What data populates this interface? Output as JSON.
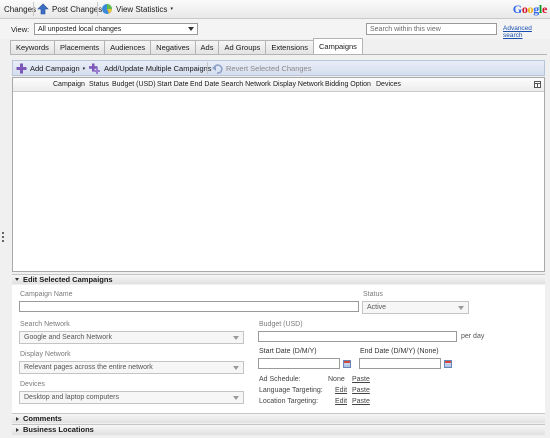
{
  "toolbar": {
    "changes": "Changes",
    "post_changes": "Post Changes",
    "view_statistics": "View Statistics",
    "logo": "Google"
  },
  "view": {
    "label": "View:",
    "selected": "All unposted local changes",
    "search_placeholder": "Search within this view",
    "advanced_search": "Advanced search"
  },
  "tabs": [
    "Keywords",
    "Placements",
    "Audiences",
    "Negatives",
    "Ads",
    "Ad Groups",
    "Extensions",
    "Campaigns"
  ],
  "active_tab": "Campaigns",
  "actions": {
    "add_campaign": "Add Campaign",
    "add_update_multiple": "Add/Update Multiple Campaigns",
    "revert": "Revert Selected Changes"
  },
  "grid": {
    "columns": [
      "Campaign",
      "Status",
      "Budget (USD)",
      "Start Date",
      "End Date",
      "Search Network",
      "Display Network",
      "Bidding Option",
      "Devices"
    ]
  },
  "edit": {
    "header": "Edit Selected Campaigns",
    "campaign_name_label": "Campaign Name",
    "status_label": "Status",
    "status_value": "Active",
    "search_network_label": "Search Network",
    "search_network_value": "Google and Search Network",
    "budget_label": "Budget (USD)",
    "per_day": "per day",
    "display_network_label": "Display Network",
    "display_network_value": "Relevant pages across the entire network",
    "start_date_label": "Start Date (D/M/Y)",
    "end_date_label": "End Date (D/M/Y) (None)",
    "devices_label": "Devices",
    "devices_value": "Desktop and laptop computers",
    "ad_schedule_label": "Ad Schedule:",
    "ad_schedule_value": "None",
    "paste": "Paste",
    "language_label": "Language Targeting:",
    "location_label": "Location Targeting:",
    "edit_link": "Edit"
  },
  "sections": {
    "comments": "Comments",
    "business_locations": "Business Locations"
  },
  "colors": {
    "accent_blue": "#1a4fb0",
    "action_bar": "#d5deee"
  }
}
